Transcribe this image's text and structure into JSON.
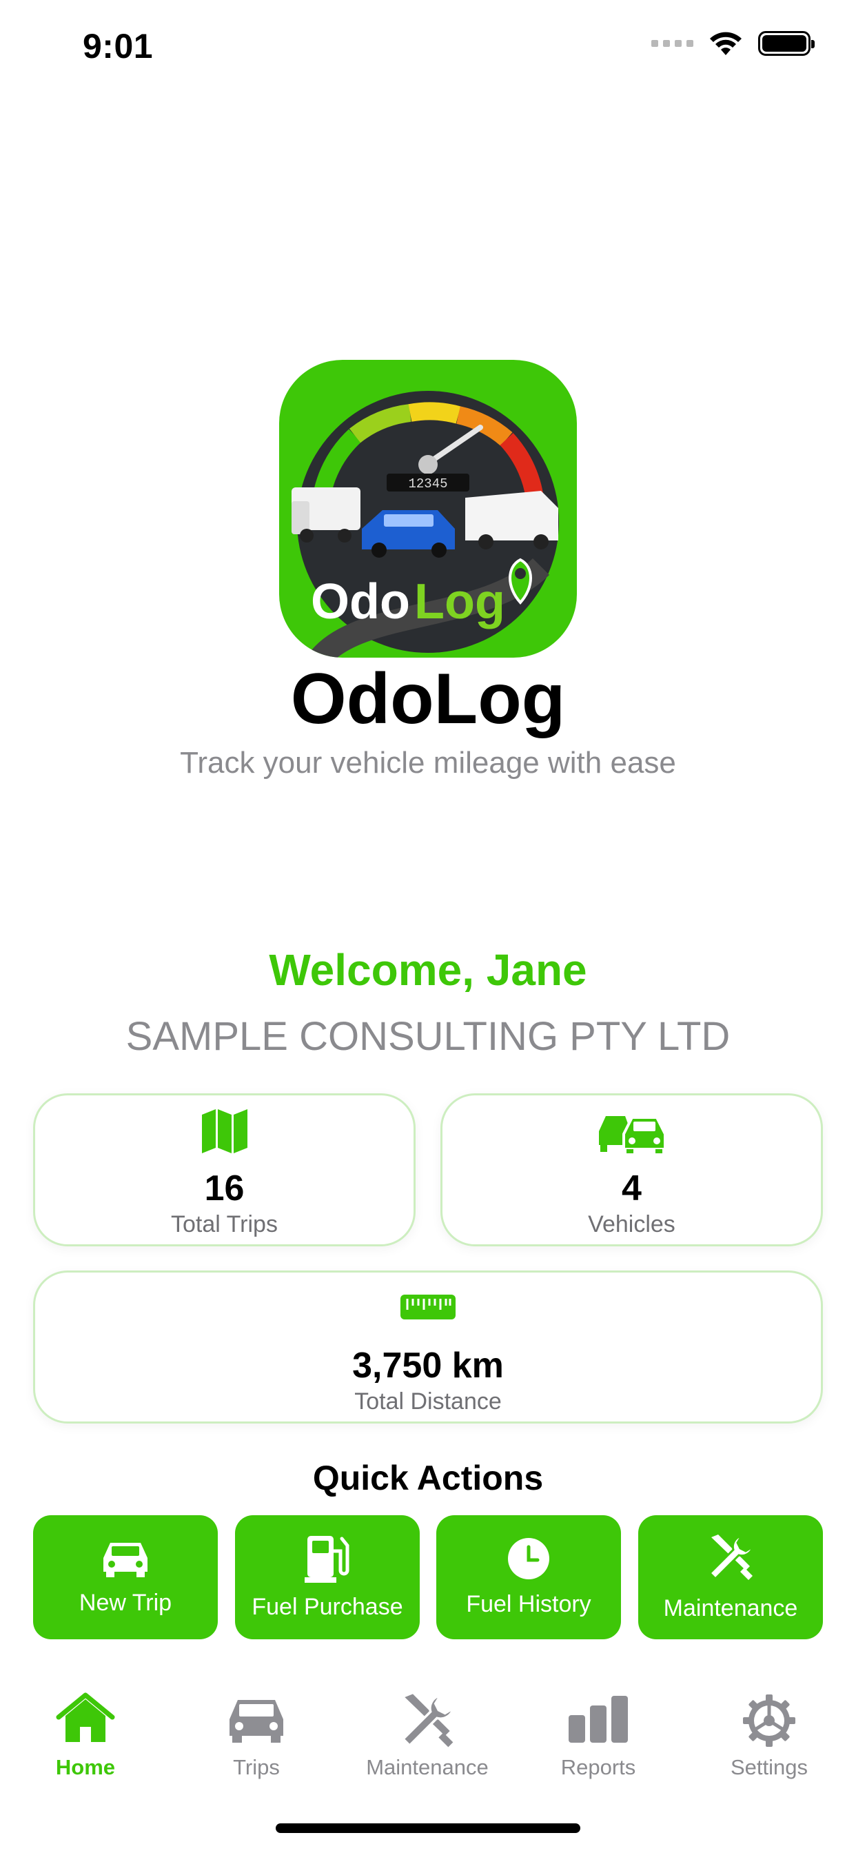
{
  "status_bar": {
    "time": "9:01",
    "icons": [
      "signal-icon",
      "wifi-icon",
      "battery-icon"
    ]
  },
  "logo": {
    "text_odo": "Odo",
    "text_log": "Log",
    "odometer": "12345"
  },
  "app": {
    "name": "OdoLog",
    "tagline": "Track your vehicle mileage with ease"
  },
  "user": {
    "welcome": "Welcome, Jane",
    "company": "SAMPLE CONSULTING PTY LTD"
  },
  "stats": {
    "trips": {
      "value": "16",
      "label": "Total Trips",
      "icon": "map-icon"
    },
    "vehicles": {
      "value": "4",
      "label": "Vehicles",
      "icon": "cars-icon"
    },
    "distance": {
      "value": "3,750 km",
      "label": "Total Distance",
      "icon": "ruler-icon"
    }
  },
  "quick_actions": {
    "title": "Quick Actions",
    "items": [
      {
        "label": "New Trip",
        "icon": "car-icon"
      },
      {
        "label": "Fuel Purchase",
        "icon": "fuel-pump-icon"
      },
      {
        "label": "Fuel History",
        "icon": "clock-icon"
      },
      {
        "label": "Maintenance",
        "icon": "tools-icon"
      }
    ]
  },
  "tabs": [
    {
      "label": "Home",
      "icon": "home-icon",
      "active": true
    },
    {
      "label": "Trips",
      "icon": "car-icon",
      "active": false
    },
    {
      "label": "Maintenance",
      "icon": "tools-icon",
      "active": false
    },
    {
      "label": "Reports",
      "icon": "bar-chart-icon",
      "active": false
    },
    {
      "label": "Settings",
      "icon": "gear-icon",
      "active": false
    }
  ],
  "colors": {
    "accent": "#3ec708",
    "secondary_text": "#8a8a8e",
    "card_border": "#cdeec0",
    "inactive_icon": "#8e8e93"
  }
}
